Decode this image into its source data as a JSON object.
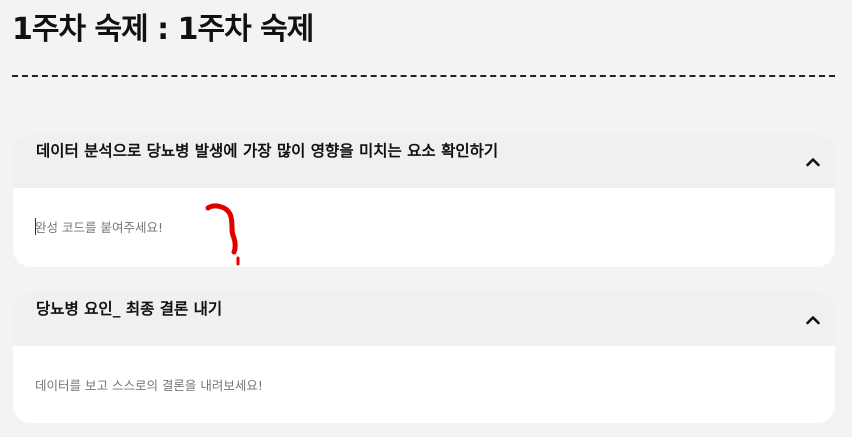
{
  "page": {
    "title": "1주차 숙제 : 1주차 숙제"
  },
  "cards": [
    {
      "title": "데이터 분석으로 당뇨병 발생에 가장 많이 영향을 미치는 요소 확인하기",
      "placeholder": "완성 코드를 붙여주세요!",
      "value": ""
    },
    {
      "title": "당뇨병 요인_ 최종 결론 내기",
      "placeholder": "데이터를 보고 스스로의 결론을 내려보세요!",
      "value": ""
    }
  ],
  "icons": {
    "collapse": "chevron-up-icon"
  },
  "colors": {
    "background": "#f2f3f5",
    "card_header": "#f0f0f0",
    "card_body": "#ffffff",
    "annotation": "#e00000"
  }
}
